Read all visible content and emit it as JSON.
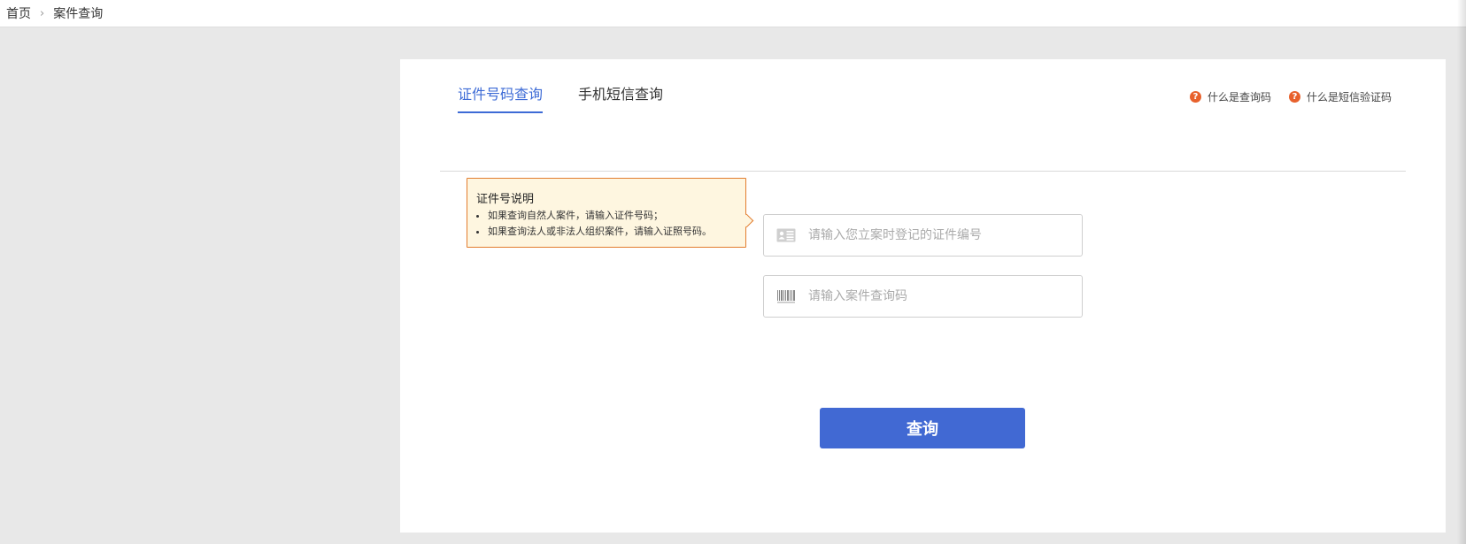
{
  "breadcrumb": {
    "home": "首页",
    "separator": "›",
    "current": "案件查询"
  },
  "tabs": [
    {
      "label": "证件号码查询",
      "active": true
    },
    {
      "label": "手机短信查询",
      "active": false
    }
  ],
  "help_links": [
    {
      "icon": "question-icon",
      "label": "什么是查询码"
    },
    {
      "icon": "question-icon",
      "label": "什么是短信验证码"
    }
  ],
  "tooltip": {
    "title": "证件号说明",
    "items": [
      "如果查询自然人案件，请输入证件号码；",
      "如果查询法人或非法人组织案件，请输入证照号码。"
    ]
  },
  "fields": {
    "id_number": {
      "placeholder": "请输入您立案时登记的证件编号",
      "value": "",
      "icon": "id-card-icon"
    },
    "case_code": {
      "placeholder": "请输入案件查询码",
      "value": "",
      "icon": "barcode-icon"
    }
  },
  "submit_label": "查询",
  "colors": {
    "accent": "#3d6bd6",
    "button": "#4169d3",
    "help_icon": "#e8612c",
    "tooltip_border": "#e27d2e",
    "tooltip_bg": "#fef6e0"
  }
}
